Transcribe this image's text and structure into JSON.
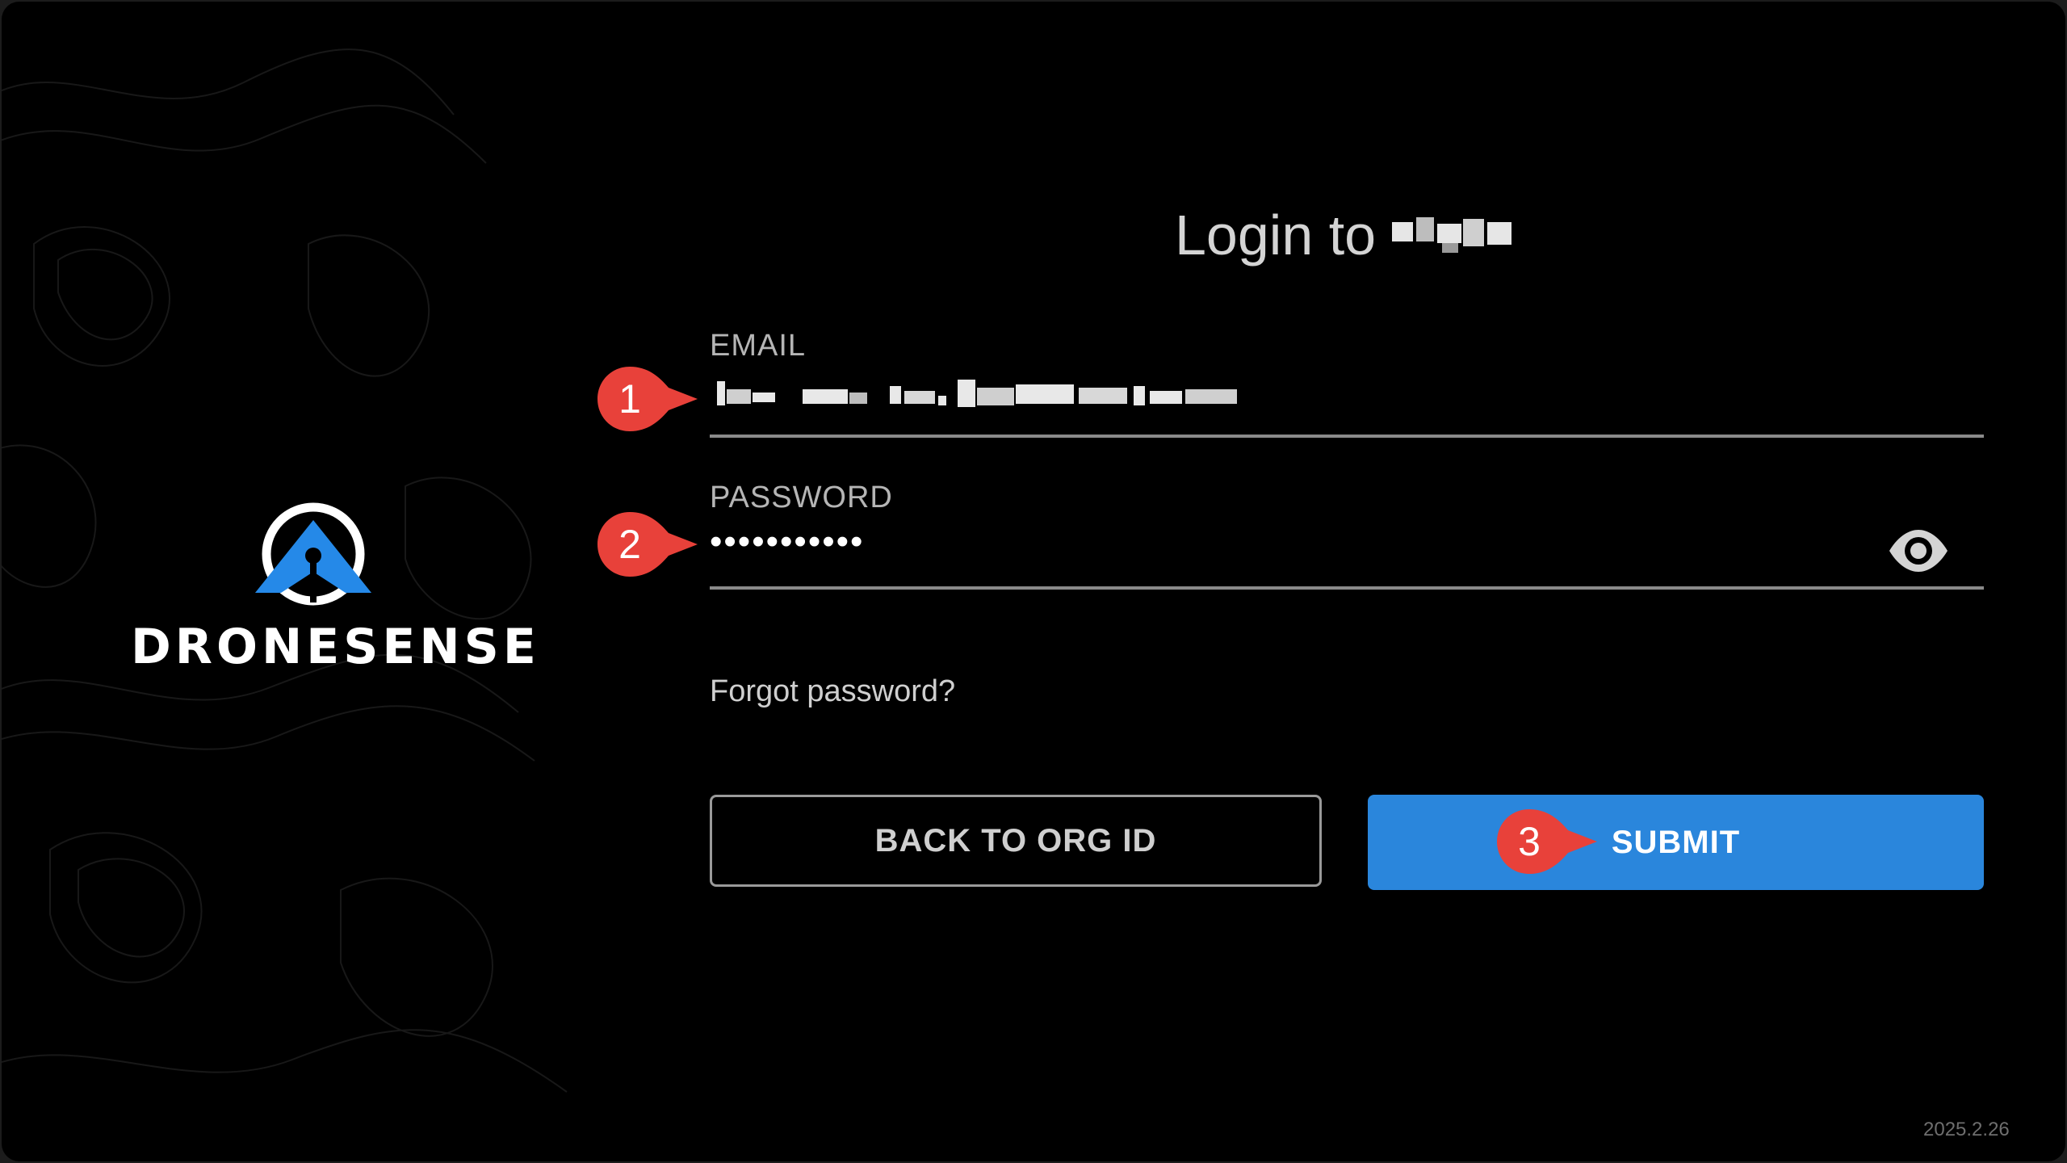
{
  "login": {
    "title": "Login to",
    "email_label": "EMAIL",
    "password_label": "PASSWORD",
    "password_value": "•••••••••••",
    "forgot_link": "Forgot password?",
    "back_button": "BACK TO ORG ID",
    "submit_button": "SUBMIT"
  },
  "brand": {
    "name": "DRONESENSE",
    "logo_icon": "dronesense-logo-icon",
    "accent_color": "#2a86dc"
  },
  "icons": {
    "password_toggle": "eye-icon"
  },
  "footer": {
    "version": "2025.2.26"
  },
  "annotations": {
    "markers": [
      "1",
      "2",
      "3"
    ],
    "marker_color": "#e8413a"
  }
}
